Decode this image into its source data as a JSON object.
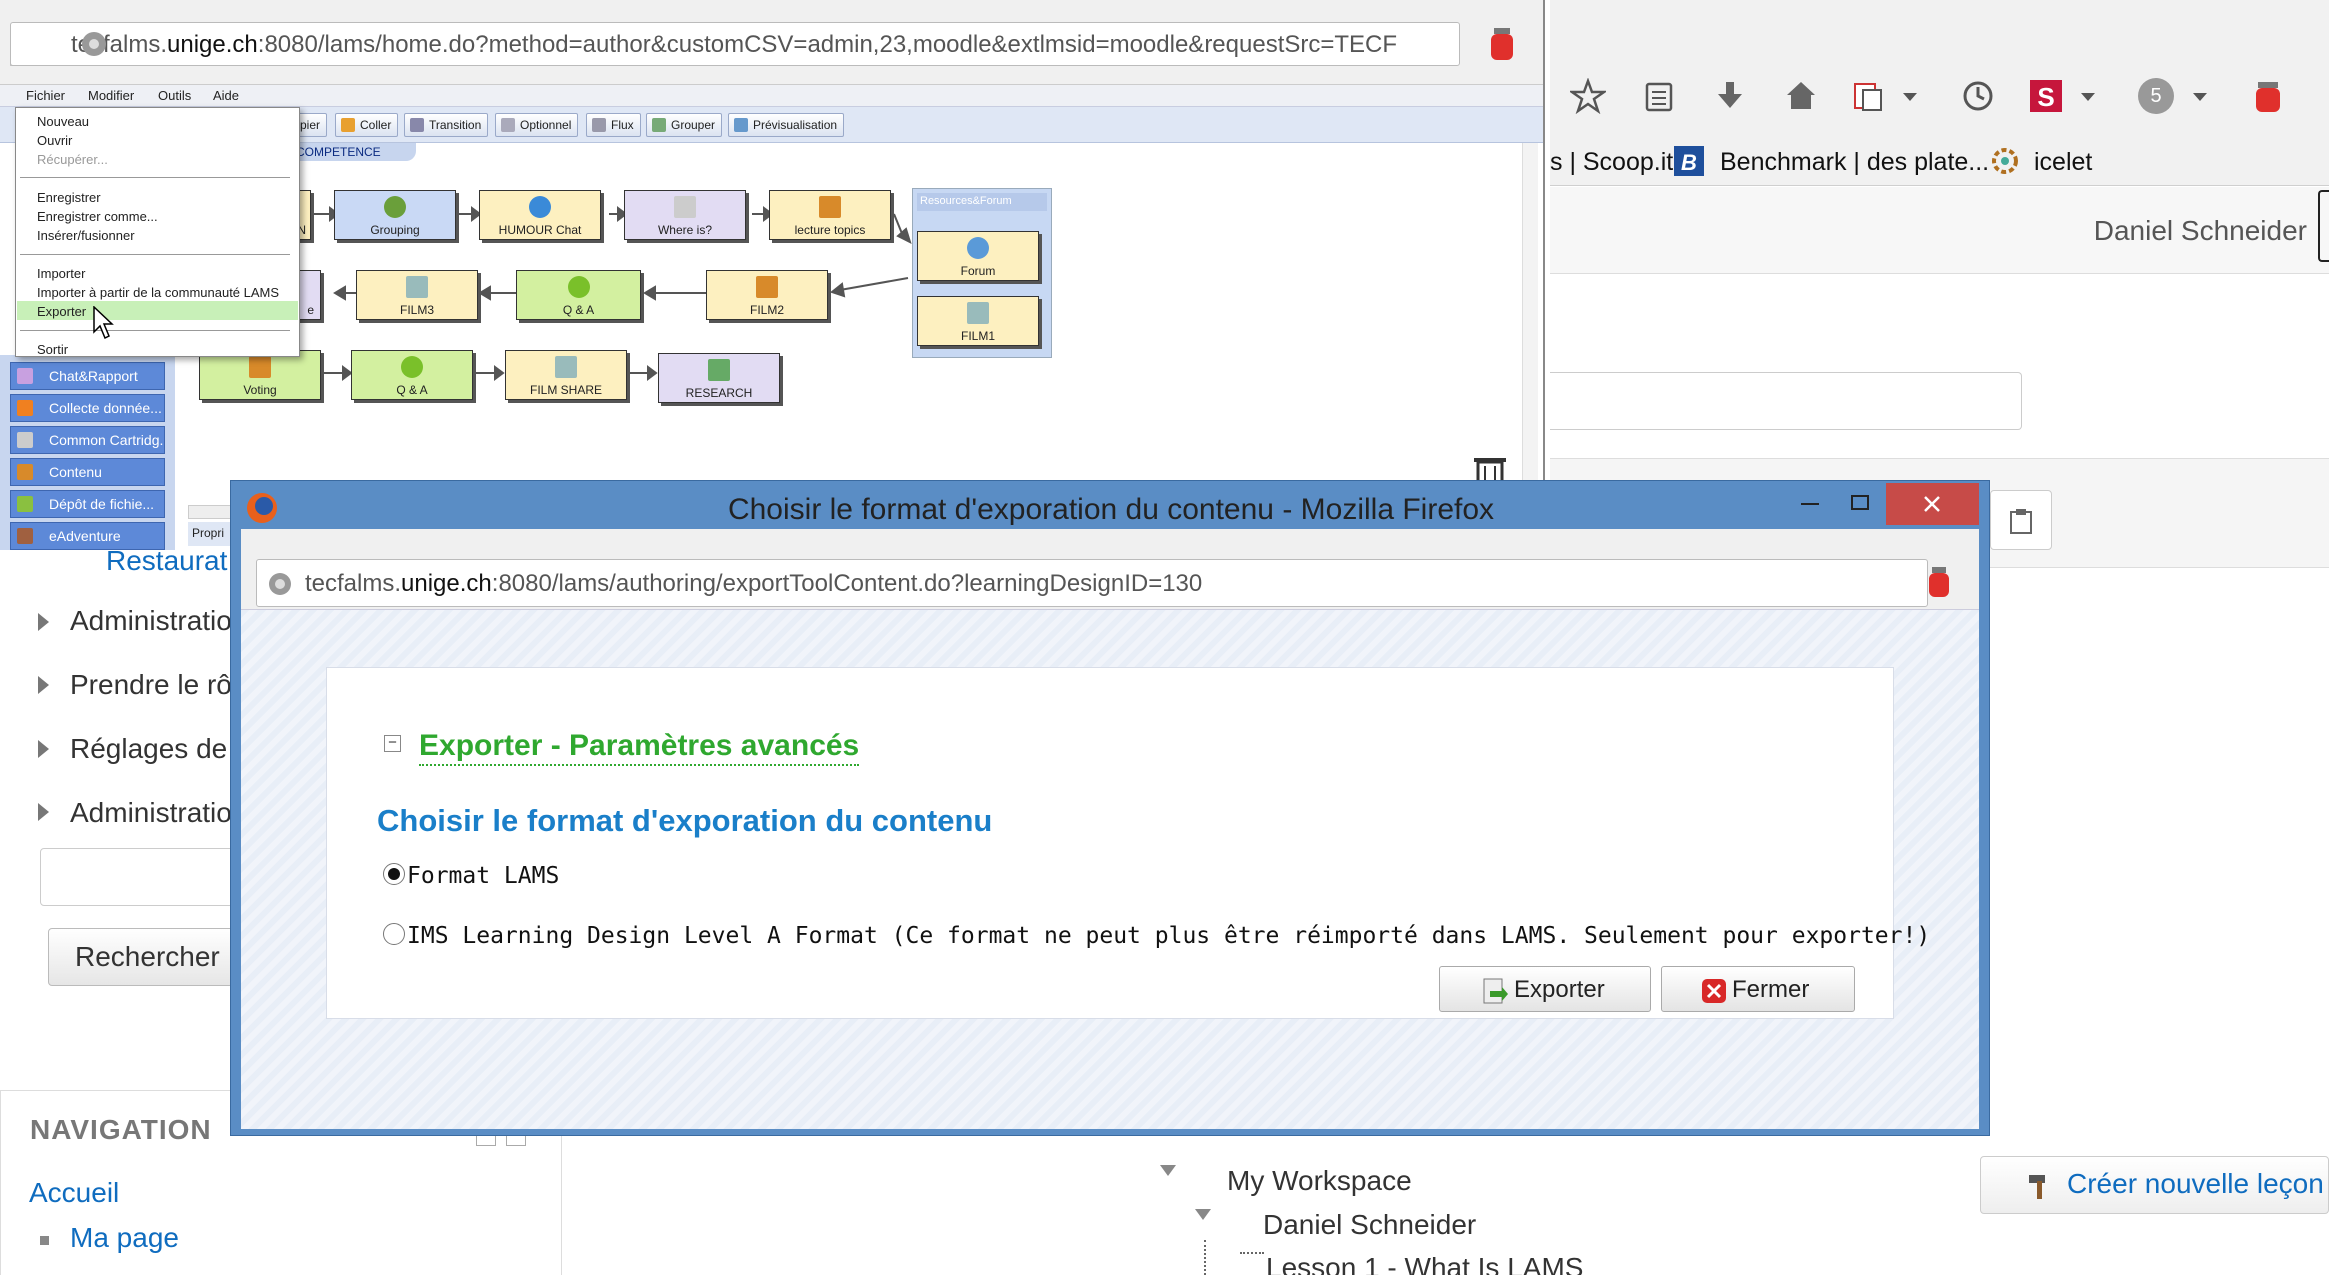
{
  "lams_window": {
    "url_prefix": "tecfalms.",
    "url_domain": "unige.ch",
    "url_rest": ":8080/lams/home.do?method=author&customCSV=admin,23,moodle&extlmsid=moodle&requestSrc=TECF",
    "menu": [
      "Fichier",
      "Modifier",
      "Outils",
      "Aide"
    ],
    "toolbar": [
      "pier",
      "Coller",
      "Transition",
      "Optionnel",
      "Flux",
      "Grouper",
      "Prévisualisation"
    ],
    "canvas_tab": "COMPETENCE",
    "activities": {
      "a_n": "N",
      "grouping": "Grouping",
      "humour_chat": "HUMOUR Chat",
      "where_is": "Where is?",
      "lecture_topics": "lecture topics",
      "a_e": "e",
      "film3": "FILM3",
      "qa1": "Q & A",
      "film2": "FILM2",
      "voting": "Voting",
      "qa2": "Q & A",
      "film_share": "FILM SHARE",
      "research": "RESEARCH",
      "forum": "Forum",
      "film1": "FILM1"
    },
    "resources_group_title": "Resources&Forum",
    "palette": [
      "Chat&Rapport",
      "Collecte donnée...",
      "Common Cartridg...",
      "Contenu",
      "Dépôt de fichie...",
      "eAdventure"
    ],
    "properties_tab": "Propri"
  },
  "file_menu": {
    "items": [
      "Nouveau",
      "Ouvrir",
      "Récupérer...",
      "Enregistrer",
      "Enregistrer comme...",
      "Insérer/fusionner",
      "Importer",
      "Importer à partir de la communauté LAMS",
      "Exporter",
      "Sortir"
    ]
  },
  "bg_browser": {
    "bookmarks": [
      "s | Scoop.it",
      "Benchmark | des plate...",
      "icelet"
    ],
    "badge": "5",
    "user_name": "Daniel Schneider"
  },
  "moodle": {
    "partial_link": "Restaurat",
    "admin_items": [
      "Administratio",
      "Prendre le rô",
      "Réglages de",
      "Administratio"
    ],
    "search_button": "Rechercher",
    "navigation_title": "NAVIGATION",
    "nav_home": "Accueil",
    "nav_my_page": "Ma page",
    "workspace": [
      "My Workspace",
      "Daniel Schneider",
      "Lesson 1 - What Is LAMS"
    ],
    "create_button": "Créer nouvelle leçon"
  },
  "dialog": {
    "title": "Choisir le format d'exporation du contenu - Mozilla Firefox",
    "url_prefix": "tecfalms.",
    "url_domain": "unige.ch",
    "url_rest": ":8080/lams/authoring/exportToolContent.do?learningDesignID=130",
    "advanced_title": "Exporter - Paramètres avancés",
    "section_title": "Choisir le format d'exporation du contenu",
    "option_lams": "Format LAMS",
    "option_ims": "IMS Learning Design Level A Format (Ce format ne peut plus être réimporté dans LAMS. Seulement pour exporter!)",
    "export_button": "Exporter",
    "close_button": "Fermer"
  },
  "colors": {
    "dialog_frame": "#5a8dc5",
    "advanced_green": "#2fa82f",
    "section_blue": "#1a7fc9",
    "moodle_link": "#0f6cbf"
  }
}
